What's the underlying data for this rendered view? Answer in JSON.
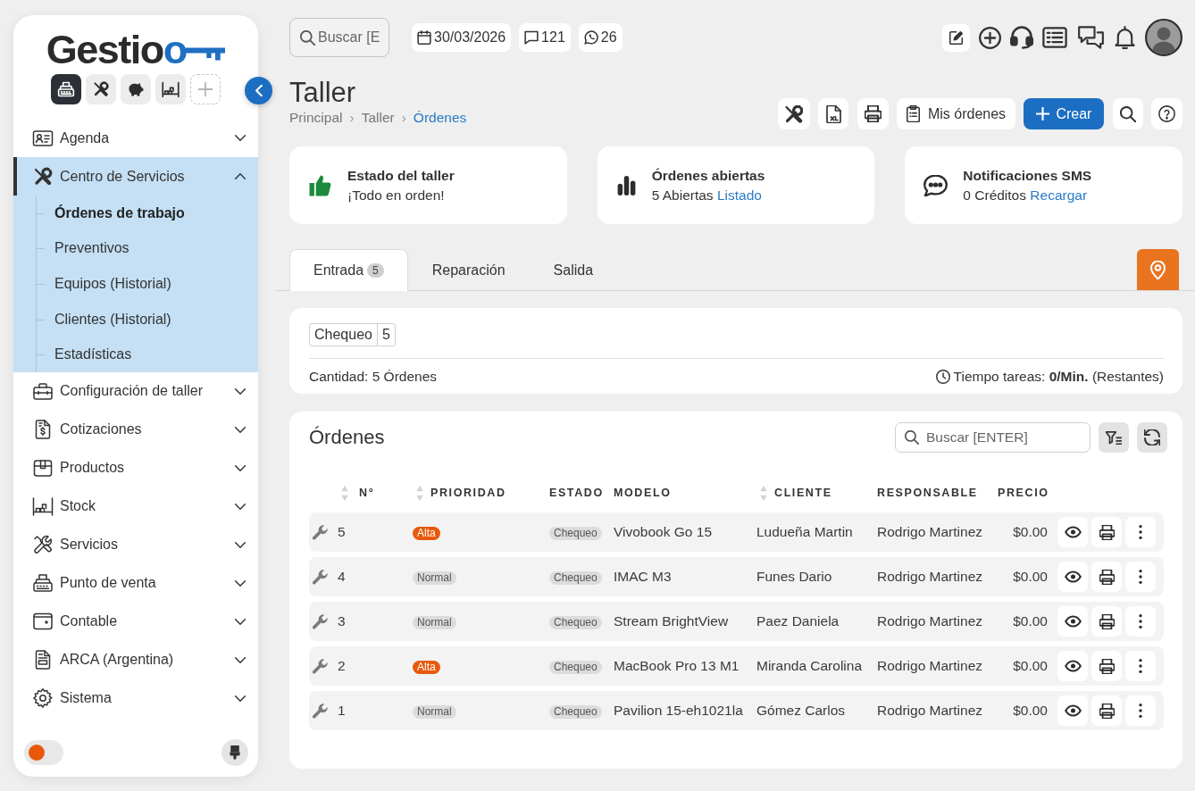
{
  "sidebar": {
    "logo": {
      "text": "Gestio",
      "accent": "o"
    },
    "apps": [
      {
        "selected": true
      },
      {
        "selected": false
      },
      {
        "selected": false
      },
      {
        "selected": false
      }
    ],
    "menu": [
      {
        "label": "Agenda",
        "selected": false,
        "expanded": false
      },
      {
        "label": "Centro de Servicios",
        "selected": true,
        "expanded": true,
        "children": [
          {
            "label": "Órdenes de trabajo",
            "selected": true
          },
          {
            "label": "Preventivos",
            "selected": false
          },
          {
            "label": "Equipos (Historial)",
            "selected": false
          },
          {
            "label": "Clientes (Historial)",
            "selected": false
          },
          {
            "label": "Estadísticas",
            "selected": false
          }
        ]
      },
      {
        "label": "Configuración de taller",
        "selected": false,
        "expanded": false
      },
      {
        "label": "Cotizaciones",
        "selected": false,
        "expanded": false
      },
      {
        "label": "Productos",
        "selected": false,
        "expanded": false
      },
      {
        "label": "Stock",
        "selected": false,
        "expanded": false
      },
      {
        "label": "Servicios",
        "selected": false,
        "expanded": false
      },
      {
        "label": "Punto de venta",
        "selected": false,
        "expanded": false
      },
      {
        "label": "Contable",
        "selected": false,
        "expanded": false
      },
      {
        "label": "ARCA (Argentina)",
        "selected": false,
        "expanded": false
      },
      {
        "label": "Sistema",
        "selected": false,
        "expanded": false
      }
    ],
    "theme_toggle": {
      "on": false
    }
  },
  "top_bar": {
    "search": {
      "placeholder": "Buscar [E"
    },
    "indicators": [
      {
        "text": "30/03/2026"
      },
      {
        "text": "121"
      },
      {
        "text": "26"
      }
    ]
  },
  "page": {
    "title": "Taller",
    "breadcrumb_separator": "›",
    "breadcrumb": [
      {
        "label": "Principal",
        "current": false
      },
      {
        "label": "Taller",
        "current": false
      },
      {
        "label": "Órdenes",
        "current": true
      }
    ]
  },
  "toolbar_buttons": [
    {
      "label": "Mis órdenes",
      "kind": "secondary"
    },
    {
      "label": "Crear",
      "kind": "primary"
    }
  ],
  "summary_cards": [
    {
      "title": "Estado del taller",
      "text": "¡Todo en orden!"
    },
    {
      "title": "Órdenes abiertas",
      "text": "5 Abiertas",
      "link": "Listado"
    },
    {
      "title": "Notificaciones SMS",
      "text": "0 Créditos",
      "link": "Recargar"
    }
  ],
  "tabs": [
    {
      "label": "Entrada",
      "count": "5",
      "selected": true
    },
    {
      "label": "Reparación",
      "selected": false
    },
    {
      "label": "Salida",
      "selected": false
    }
  ],
  "status_chips": [
    {
      "label": "Chequeo",
      "count": "5"
    }
  ],
  "quantity_text": "Cantidad: 5 Órdenes",
  "task_time_text": "Tiempo tareas: **0/Min.** (Restantes)",
  "orders": {
    "title": "Órdenes",
    "search": {
      "placeholder": "Buscar [ENTER]"
    },
    "columns": [
      {
        "label": "N°",
        "sortable": true
      },
      {
        "label": "PRIORIDAD",
        "sortable": true
      },
      {
        "label": "ESTADO",
        "sortable": false
      },
      {
        "label": "MODELO",
        "sortable": false
      },
      {
        "label": "CLIENTE",
        "sortable": true
      },
      {
        "label": "RESPONSABLE",
        "sortable": false
      },
      {
        "label": "PRECIO",
        "sortable": false
      }
    ],
    "rows": [
      {
        "number": "5",
        "priority": {
          "text": "Alta",
          "color": "#e8590c"
        },
        "status": "Chequeo",
        "model": "Vivobook Go 15",
        "client": "Ludueña Martin",
        "responsible": "Rodrigo Martinez",
        "price": "$0.00"
      },
      {
        "number": "4",
        "priority": {
          "text": "Normal",
          "color": "#dcdcdc"
        },
        "status": "Chequeo",
        "model": "IMAC M3",
        "client": "Funes Dario",
        "responsible": "Rodrigo Martinez",
        "price": "$0.00"
      },
      {
        "number": "3",
        "priority": {
          "text": "Normal",
          "color": "#dcdcdc"
        },
        "status": "Chequeo",
        "model": "Stream BrightView",
        "client": "Paez Daniela",
        "responsible": "Rodrigo Martinez",
        "price": "$0.00"
      },
      {
        "number": "2",
        "priority": {
          "text": "Alta",
          "color": "#e8590c"
        },
        "status": "Chequeo",
        "model": "MacBook Pro 13 M1",
        "client": "Miranda Carolina",
        "responsible": "Rodrigo Martinez",
        "price": "$0.00"
      },
      {
        "number": "1",
        "priority": {
          "text": "Normal",
          "color": "#dcdcdc"
        },
        "status": "Chequeo",
        "model": "Pavilion 15-eh1021la",
        "client": "Gómez Carlos",
        "responsible": "Rodrigo Martinez",
        "price": "$0.00"
      }
    ]
  }
}
